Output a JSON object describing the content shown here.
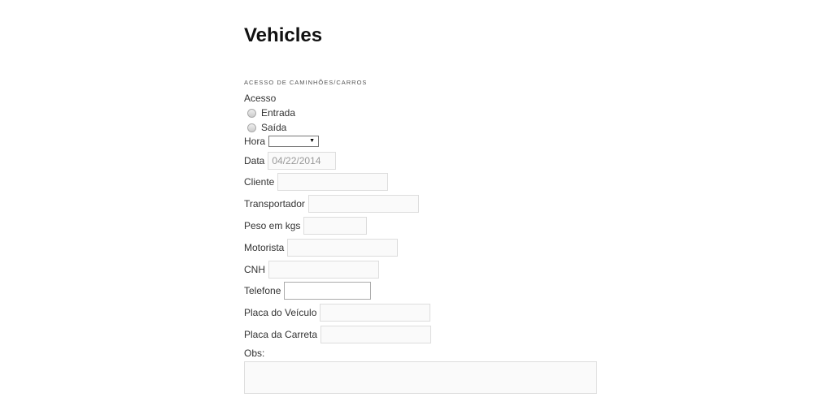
{
  "page_title": "Vehicles",
  "section_title": "ACESSO DE CAMINHÕES/CARROS",
  "acesso": {
    "label": "Acesso",
    "options": [
      "Entrada",
      "Saída"
    ]
  },
  "hora": {
    "label": "Hora",
    "value": "",
    "arrow": "▼"
  },
  "data": {
    "label": "Data",
    "value": "04/22/2014"
  },
  "fields": {
    "cliente": "Cliente",
    "transportador": "Transportador",
    "peso": "Peso em kgs",
    "motorista": "Motorista",
    "cnh": "CNH",
    "telefone": "Telefone",
    "placa_veiculo": "Placa do Veículo",
    "placa_carreta": "Placa da Carreta"
  },
  "obs": {
    "label": "Obs:"
  }
}
